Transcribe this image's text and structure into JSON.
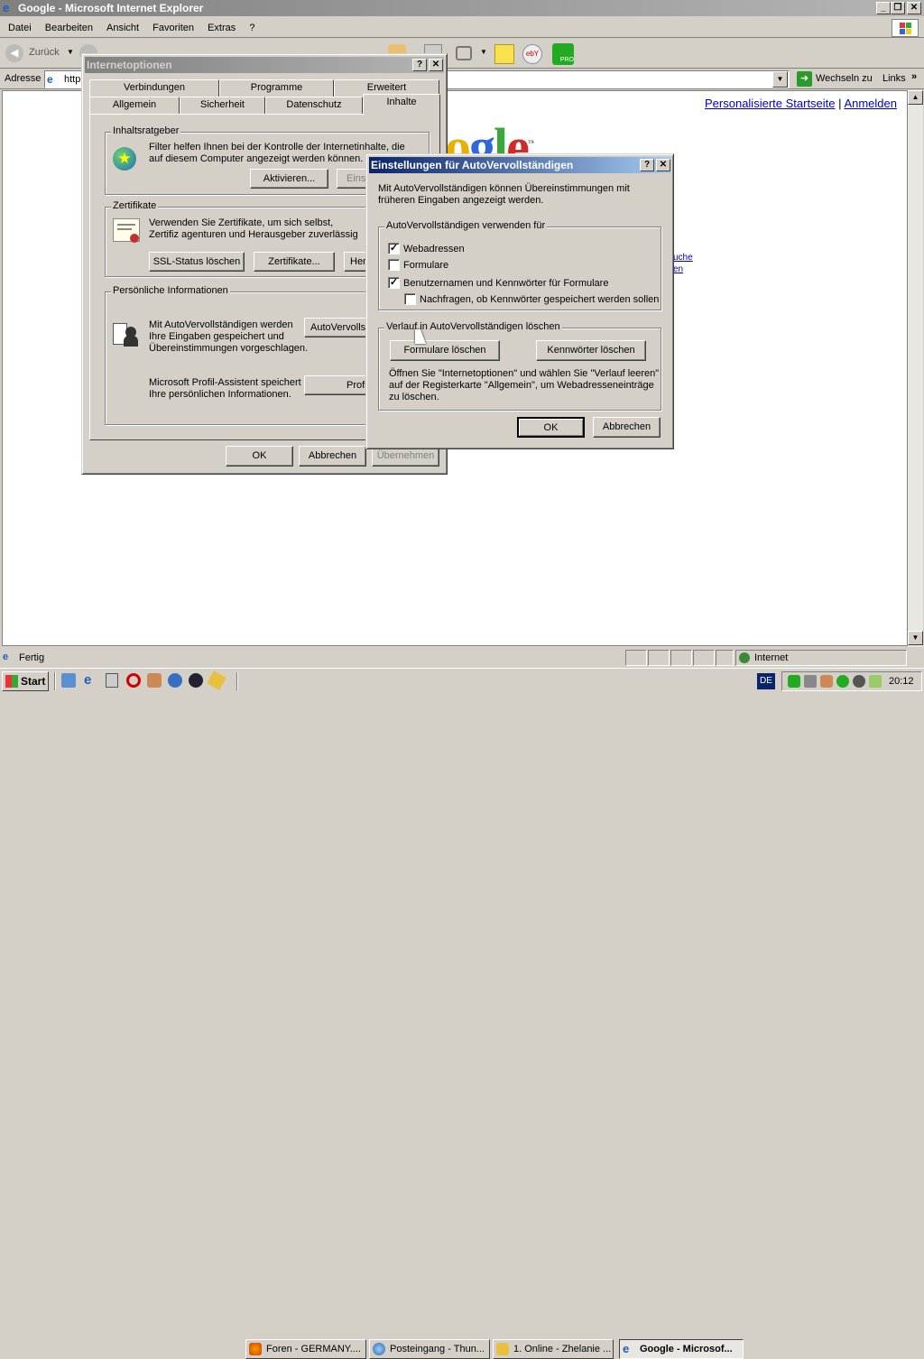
{
  "browser": {
    "title": "Google - Microsoft Internet Explorer",
    "menu": [
      "Datei",
      "Bearbeiten",
      "Ansicht",
      "Favoriten",
      "Extras",
      "?"
    ],
    "back_label": "Zurück",
    "address_label": "Adresse",
    "address_value": "http",
    "go_label": "Wechseln zu",
    "links_label": "Links",
    "status_text": "Fertig",
    "zone_text": "Internet",
    "page_links": {
      "personalize": "Personalisierte Startseite",
      "separator": "|",
      "login": "Anmelden"
    },
    "page_frag1": "uche",
    "page_frag2": "en"
  },
  "internetoptions": {
    "title": "Internetoptionen",
    "tabs_back": [
      "Verbindungen",
      "Programme",
      "Erweitert"
    ],
    "tabs_front": [
      "Allgemein",
      "Sicherheit",
      "Datenschutz",
      "Inhalte"
    ],
    "content_advisor": {
      "label": "Inhaltsratgeber",
      "text": "Filter helfen Ihnen bei der Kontrolle der Internetinhalte, die auf diesem Computer angezeigt werden können.",
      "enable": "Aktivieren...",
      "settings": "Einst"
    },
    "certificates": {
      "label": "Zertifikate",
      "text": "Verwenden Sie Zertifikate, um sich selbst, Zertifiz agenturen und Herausgeber zuverlässig zu identifiz",
      "ssl": "SSL-Status löschen",
      "certs": "Zertifikate...",
      "publishers": "Hera"
    },
    "personal": {
      "label": "Persönliche Informationen",
      "autocomplete_text": "Mit AutoVervollständigen werden Ihre Eingaben gespeichert und Übereinstimmungen vorgeschlagen.",
      "autocomplete_btn": "AutoVervolls",
      "profile_text": "Microsoft Profil-Assistent speichert Ihre persönlichen Informationen.",
      "profile_btn": "Profi"
    },
    "ok": "OK",
    "cancel": "Abbrechen",
    "apply": "Übernehmen"
  },
  "autocomplete": {
    "title": "Einstellungen für AutoVervollständigen",
    "intro": "Mit AutoVervollständigen können Übereinstimmungen mit früheren Eingaben angezeigt werden.",
    "use_group": "AutoVervollständigen verwenden für",
    "options": [
      {
        "label": "Webadressen",
        "checked": "✓"
      },
      {
        "label": "Formulare",
        "checked": ""
      },
      {
        "label": "Benutzernamen und Kennwörter für Formulare",
        "checked": "✓"
      },
      {
        "label": "Nachfragen, ob Kennwörter gespeichert werden sollen",
        "checked": ""
      }
    ],
    "clear_group": "Verlauf in AutoVervollständigen löschen",
    "clear_forms": "Formulare löschen",
    "clear_passwords": "Kennwörter löschen",
    "clear_text": "Öffnen Sie \"Internetoptionen\" und wählen Sie \"Verlauf leeren\" auf der Registerkarte \"Allgemein\", um Webadresseneinträge zu löschen.",
    "ok": "OK",
    "cancel": "Abbrechen"
  },
  "taskbar": {
    "start": "Start",
    "tasks": [
      "Foren - GERMANY....",
      "Posteingang - Thun...",
      "1. Online - Zhelanie ...",
      "Google - Microsof..."
    ],
    "lang": "DE",
    "clock": "20:12"
  }
}
